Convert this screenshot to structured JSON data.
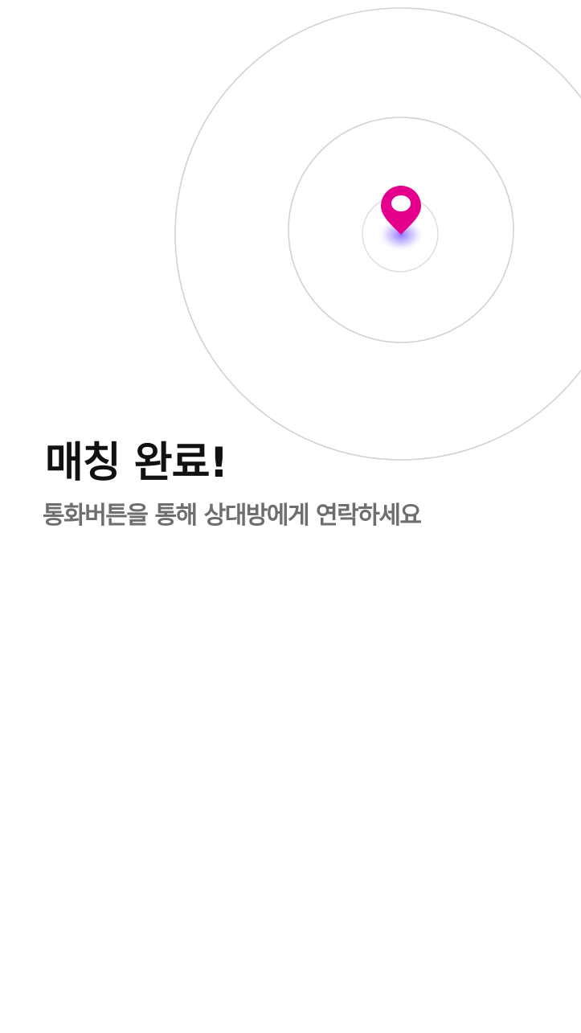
{
  "match": {
    "title": "매칭 완료!",
    "subtitle": "통화버튼을 통해 상대방에게 연락하세요"
  },
  "radar": {
    "pin_icon": "location-pin-icon",
    "pin_color": "#e4008c",
    "glow_color": "#7b5cff",
    "ring_color": "#d2d2d2"
  }
}
